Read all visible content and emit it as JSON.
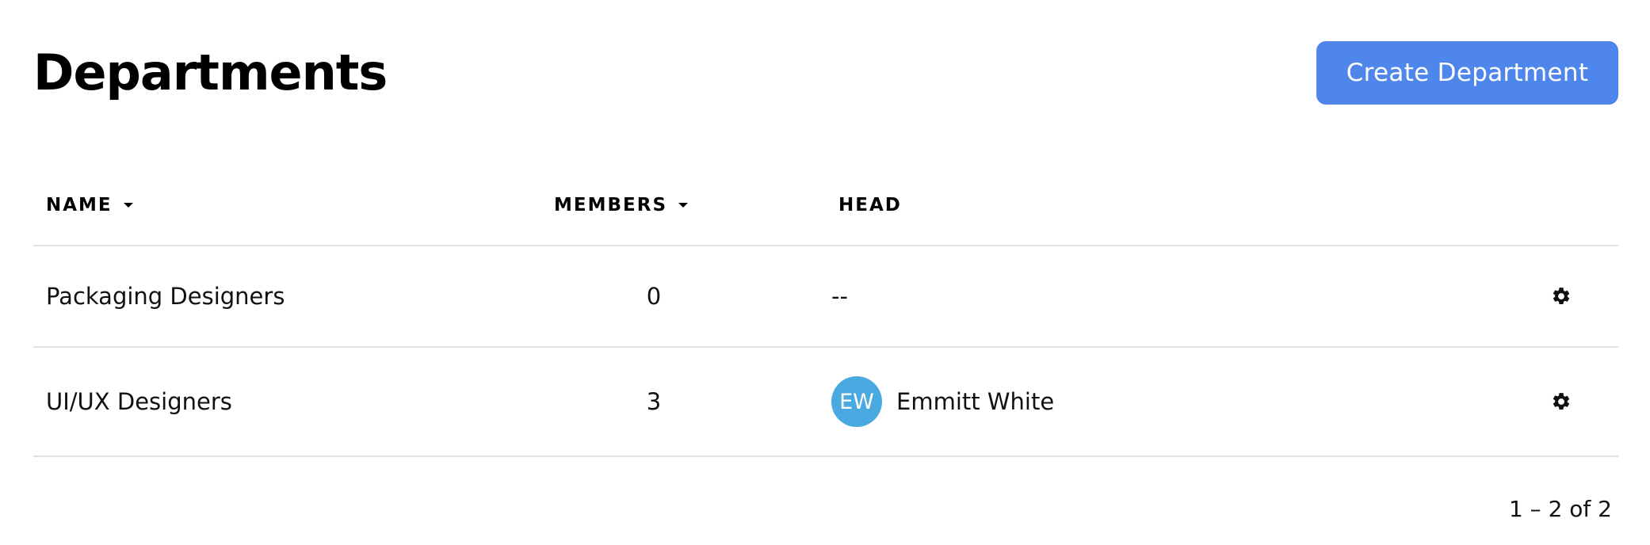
{
  "header": {
    "title": "Departments",
    "create_button_label": "Create Department"
  },
  "colors": {
    "primary_button": "#4f86ec",
    "avatar_background": "#4aa9e0",
    "divider": "#e2e2e2"
  },
  "table": {
    "columns": {
      "name": "NAME",
      "members": "MEMBERS",
      "head": "HEAD"
    },
    "rows": [
      {
        "name": "Packaging Designers",
        "members": "0",
        "head": "--",
        "actions_icon": "gear-icon"
      },
      {
        "name": "UI/UX Designers",
        "members": "3",
        "head_initials": "EW",
        "head": "Emmitt White",
        "actions_icon": "gear-icon"
      }
    ]
  },
  "pagination": {
    "range": "1 – 2 of 2"
  }
}
